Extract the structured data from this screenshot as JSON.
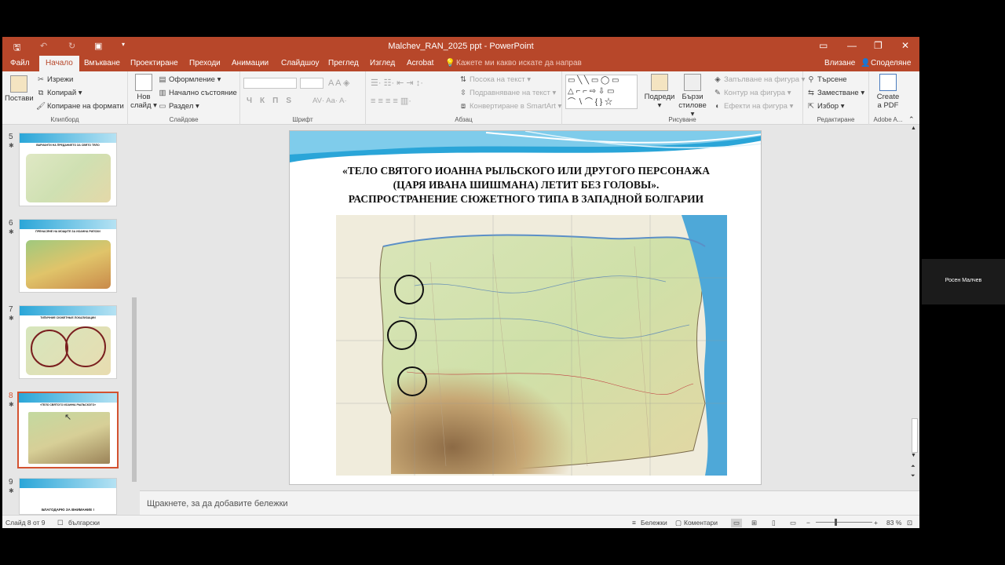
{
  "window": {
    "title": "Malchev_RAN_2025 ppt - PowerPoint"
  },
  "tabs": [
    "Файл",
    "Начало",
    "Вмъкване",
    "Проектиране",
    "Преходи",
    "Анимации",
    "Слайдшоу",
    "Преглед",
    "Изглед",
    "Acrobat"
  ],
  "tell_me": "Кажете ми какво искате да направ",
  "sign_in": "Влизане",
  "share": "Споделяне",
  "clipboard": {
    "paste": "Постави",
    "cut": "Изрежи",
    "copy": "Копирай",
    "format_painter": "Копиране на формати",
    "label": "Клипборд"
  },
  "slides_group": {
    "new_slide_1": "Нов",
    "new_slide_2": "слайд",
    "layout": "Оформление",
    "reset": "Начално състояние",
    "section": "Раздел",
    "label": "Слайдове"
  },
  "font_group": {
    "bold": "Ч",
    "italic": "К",
    "underline": "П",
    "strike": "S",
    "label": "Шрифт"
  },
  "paragraph_group": {
    "text_direction": "Посока на текст",
    "align_text": "Подравняване на текст",
    "smartart": "Конвертиране в SmartArt",
    "label": "Абзац"
  },
  "drawing_group": {
    "arrange_1": "Подреди",
    "quick_styles_1": "Бързи",
    "quick_styles_2": "стилове",
    "fill": "Запълване на фигура",
    "outline": "Контур на фигура",
    "effects": "Ефекти на фигура",
    "label": "Рисуване"
  },
  "editing_group": {
    "find": "Търсене",
    "replace": "Заместване",
    "select": "Избор",
    "label": "Редактиране"
  },
  "adobe_group": {
    "create_1": "Create",
    "create_2": "a PDF",
    "label": "Adobe A..."
  },
  "thumbnails": [
    {
      "num": "5",
      "title": "ВАРИАНТИ НА ПРЕДАНИЕТО ЗА СВЯТО ТЯЛО"
    },
    {
      "num": "6",
      "title": "ПРЕНАСЯНЕ НА МОЩИТЕ ЗА ИОАННА РИЛСКИ"
    },
    {
      "num": "7",
      "title": "ТИПИЧНИЕ СЮЖЕТНЫЕ ЛОКАЛИЗАЦИИ"
    },
    {
      "num": "8",
      "title": "«ТЕЛО СВЯТОГО ИОАННА РЫЛЬСКОГО»"
    },
    {
      "num": "9",
      "title": "БЛАГОДАРЮ ЗА ВНИМАНИЕ !"
    }
  ],
  "slide": {
    "title_l1": "«ТЕЛО СВЯТОГО ИОАННА РЫЛЬСКОГО ИЛИ ДРУГОГО ПЕРСОНАЖА",
    "title_l2": "(ЦАРЯ ИВАНА ШИШМАНА) ЛЕТИТ БЕЗ ГОЛОВЫ».",
    "title_l3": "РАСПРОСТРАНЕНИЕ СЮЖЕТНОГО ТИПА В ЗАПАДНОЙ БОЛГАРИИ"
  },
  "notes_placeholder": "Щракнете, за да добавите бележки",
  "status": {
    "slide_of": "Слайд 8 от 9",
    "language": "български",
    "notes": "Бележки",
    "comments": "Коментари",
    "zoom": "83 %"
  },
  "participant": "Росен Малчев"
}
